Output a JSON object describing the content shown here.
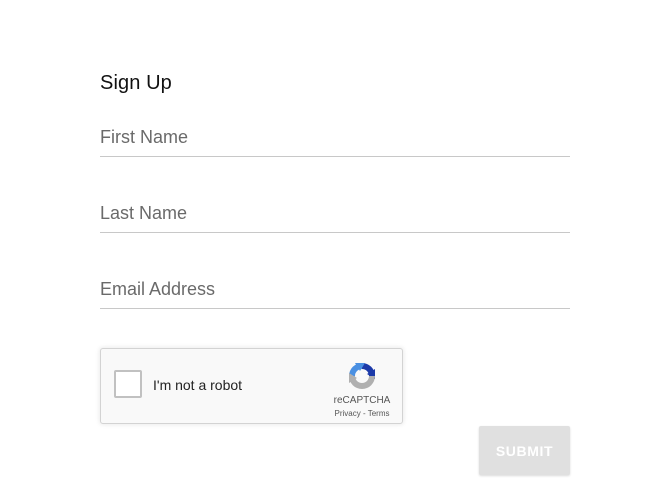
{
  "form": {
    "title": "Sign Up",
    "fields": [
      {
        "placeholder": "First Name",
        "value": ""
      },
      {
        "placeholder": "Last Name",
        "value": ""
      },
      {
        "placeholder": "Email Address",
        "value": ""
      }
    ],
    "submit_label": "SUBMIT",
    "submit_disabled": true
  },
  "recaptcha": {
    "checkbox_label": "I'm not a robot",
    "brand": "reCAPTCHA",
    "privacy_label": "Privacy",
    "separator": " - ",
    "terms_label": "Terms",
    "checked": false,
    "logo_icon": "recaptcha-logo-icon",
    "colors": {
      "blue": "#1c3aa9",
      "light_blue": "#4a90e2",
      "gray": "#b0b0b0"
    }
  }
}
